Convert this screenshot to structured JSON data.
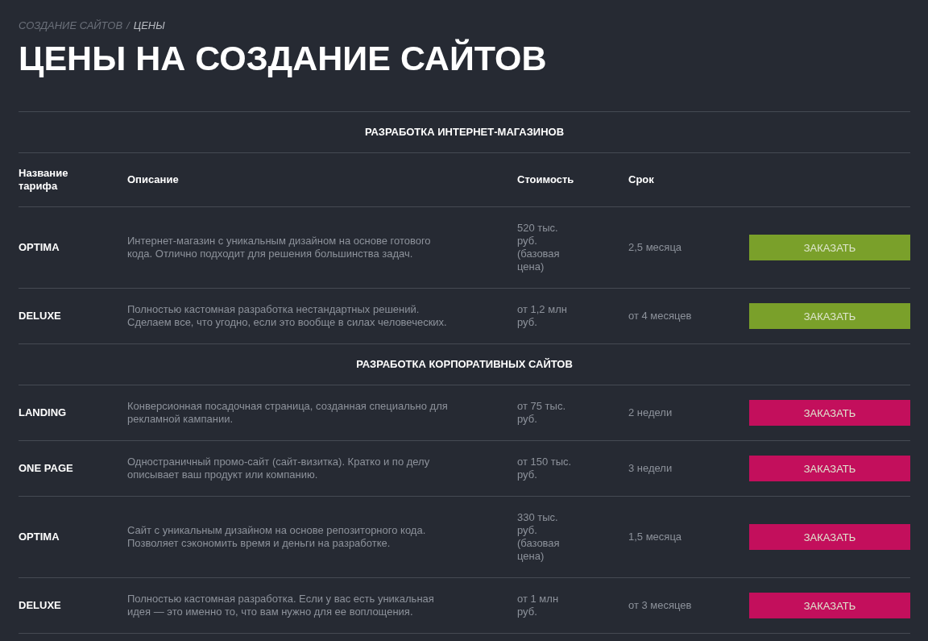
{
  "breadcrumb": [
    {
      "label": "СОЗДАНИЕ САЙТОВ",
      "selected": false
    },
    {
      "label": "/",
      "selected": false
    },
    {
      "label": "ЦЕНЫ",
      "selected": true
    }
  ],
  "title": "ЦЕНЫ НА СОЗДАНИЕ САЙТОВ",
  "sections": [
    {
      "title": "РАЗРАБОТКА ИНТЕРНЕТ-МАГАЗИНОВ",
      "color": "#7aa02a",
      "columns": [
        "Название тарифа",
        "Описание",
        "Стоимость",
        "Срок"
      ],
      "rows": [
        {
          "name": "OPTIMA",
          "description": "Интернет-магазин с уникальным дизайном на основе готового кода. Отлично подходит для решения большинства задач.",
          "price": "520 тыс. руб. (базовая цена)",
          "term": "2,5 месяца",
          "button": "ЗАКАЗАТЬ"
        },
        {
          "name": "DELUXE",
          "description": "Полностью кастомная разработка нестандартных решений. Сделаем все, что угодно, если это вообще в силах человеческих.",
          "price": "от 1,2 млн руб.",
          "term": "от 4 месяцев",
          "button": "ЗАКАЗАТЬ"
        }
      ]
    },
    {
      "title": "РАЗРАБОТКА КОРПОРАТИВНЫХ САЙТОВ",
      "color": "#c30f5c",
      "rows": [
        {
          "name": "LANDING",
          "description": "Конверсионная посадочная страница, созданная специально для рекламной кампании.",
          "price": "от 75 тыс. руб.",
          "term": "2 недели",
          "button": "ЗАКАЗАТЬ"
        },
        {
          "name": "ONE PAGE",
          "description": "Одностраничный промо-сайт (сайт-визитка). Кратко и по делу описывает ваш продукт или компанию.",
          "price": "от 150 тыс. руб.",
          "term": "3 недели",
          "button": "ЗАКАЗАТЬ"
        },
        {
          "name": "OPTIMA",
          "description": "Сайт с уникальным дизайном на основе репозиторного кода. Позволяет сэкономить время и деньги на разработке.",
          "price": "330 тыс. руб. (базовая цена)",
          "term": "1,5 месяца",
          "button": "ЗАКАЗАТЬ"
        },
        {
          "name": "DELUXE",
          "description": "Полностью кастомная разработка. Если у вас есть уникальная идея — это именно то, что вам нужно для ее воплощения.",
          "price": "от 1 млн руб.",
          "term": "от 3 месяцев",
          "button": "ЗАКАЗАТЬ"
        }
      ]
    }
  ]
}
